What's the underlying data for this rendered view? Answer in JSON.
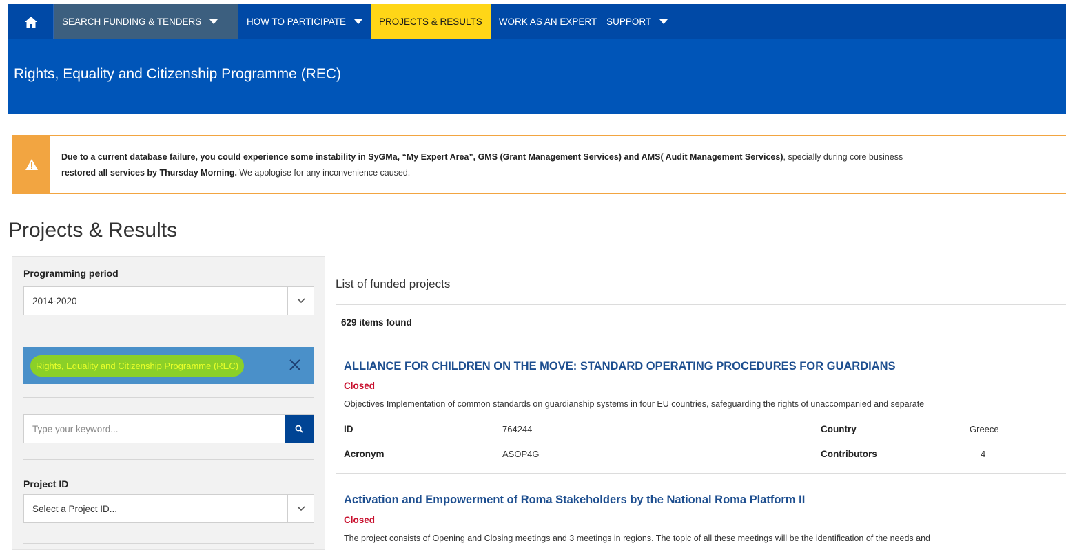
{
  "nav": {
    "items": [
      {
        "label": "SEARCH FUNDING & TENDERS"
      },
      {
        "label": "HOW TO PARTICIPATE"
      },
      {
        "label": "PROJECTS & RESULTS"
      },
      {
        "label": "WORK AS AN EXPERT"
      },
      {
        "label": "SUPPORT"
      }
    ]
  },
  "banner": {
    "title": "Rights, Equality and Citizenship Programme (REC)"
  },
  "alert": {
    "line1_bold": "Due to a current database failure, you could experience some instability in SyGMa, “My Expert Area”, GMS (Grant Management Services) and AMS( Audit Management Services)",
    "line1_rest": ", specially during core business",
    "line2_bold": "restored all services by Thursday Morning.",
    "line2_rest": " We apologise for any inconvenience caused."
  },
  "page_title": "Projects & Results",
  "sidebar": {
    "period_label": "Programming period",
    "period_value": "2014-2020",
    "programme_tag": "Rights, Equality and Citizenship Programme (REC)",
    "search_placeholder": "Type your keyword...",
    "project_id_label": "Project ID",
    "project_id_placeholder": "Select a Project ID..."
  },
  "list": {
    "title": "List of funded projects",
    "count": "629 items found",
    "projects": [
      {
        "title": "ALLIANCE FOR CHILDREN ON THE MOVE: STANDARD OPERATING PROCEDURES FOR GUARDIANS",
        "status": "Closed",
        "description": "Objectives Implementation of common standards on guardianship systems in four EU countries, safeguarding the rights of unaccompanied and separate",
        "id_label": "ID",
        "id_value": "764244",
        "acronym_label": "Acronym",
        "acronym_value": "ASOP4G",
        "country_label": "Country",
        "country_value": "Greece",
        "contributors_label": "Contributors",
        "contributors_value": "4"
      },
      {
        "title": "Activation and Empowerment of Roma Stakeholders by the National Roma Platform II",
        "status": "Closed",
        "description": "The project consists of Opening and Closing meetings and 3 meetings in regions. The topic of all these meetings will be the identification of the needs and"
      }
    ]
  },
  "colors": {
    "nav_bg": "#0049a6",
    "banner_bg": "#0055b8",
    "active_yellow": "#ffd617",
    "alert_orange": "#f2a541",
    "status_red": "#c8102e",
    "title_blue": "#1d4e8f"
  },
  "icons": [
    "home-icon",
    "caret-down-icon",
    "warning-icon",
    "chevron-down-icon",
    "close-icon",
    "search-icon"
  ]
}
